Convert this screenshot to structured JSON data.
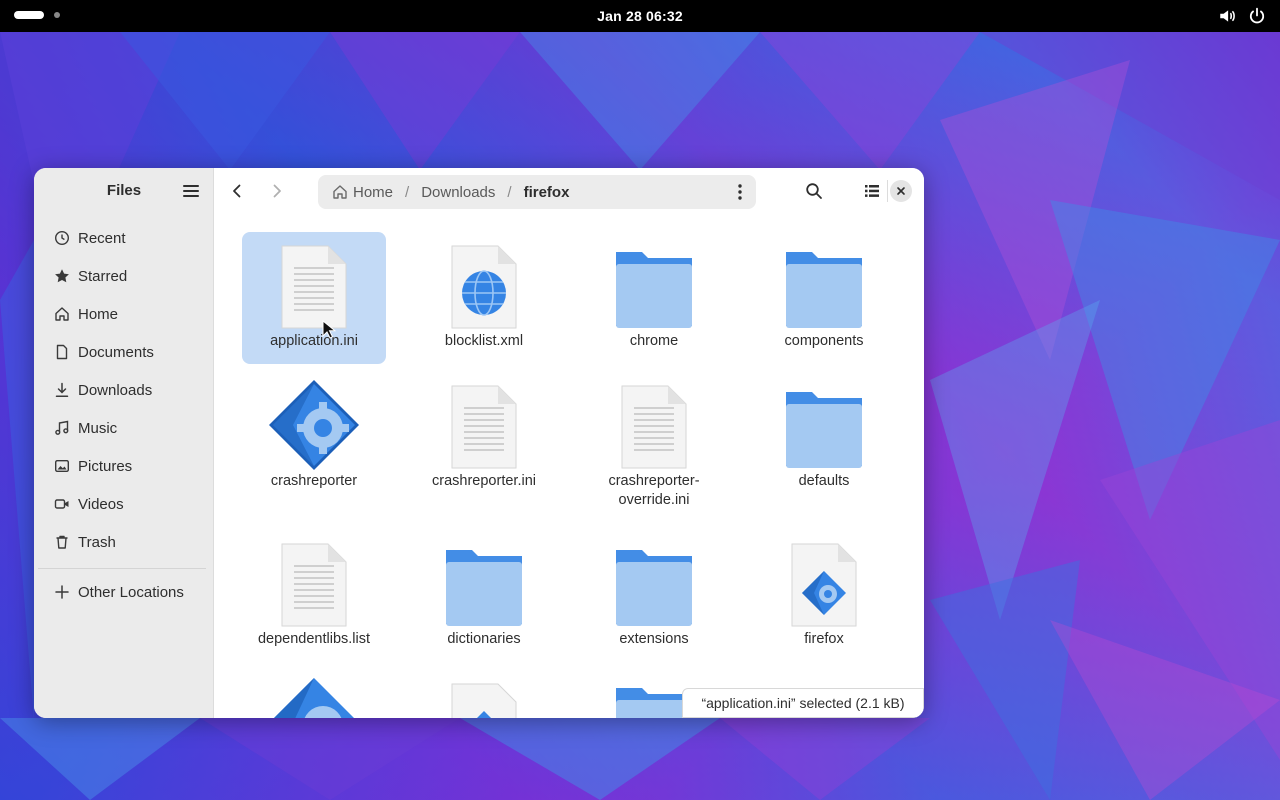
{
  "topbar": {
    "clock": "Jan 28  06:32",
    "tray_icons": [
      "volume-icon",
      "power-icon"
    ]
  },
  "window": {
    "sidebar": {
      "title": "Files",
      "items": [
        {
          "label": "Recent",
          "icon": "clock-icon"
        },
        {
          "label": "Starred",
          "icon": "star-icon"
        },
        {
          "label": "Home",
          "icon": "home-icon"
        },
        {
          "label": "Documents",
          "icon": "document-icon"
        },
        {
          "label": "Downloads",
          "icon": "download-icon"
        },
        {
          "label": "Music",
          "icon": "music-icon"
        },
        {
          "label": "Pictures",
          "icon": "picture-icon"
        },
        {
          "label": "Videos",
          "icon": "video-icon"
        },
        {
          "label": "Trash",
          "icon": "trash-icon"
        }
      ],
      "other_locations": "Other Locations"
    },
    "pathbar": {
      "crumbs": [
        "Home",
        "Downloads",
        "firefox"
      ],
      "separator": "/"
    },
    "files": [
      {
        "name": "application.ini",
        "type": "text",
        "selected": true
      },
      {
        "name": "blocklist.xml",
        "type": "web"
      },
      {
        "name": "chrome",
        "type": "folder"
      },
      {
        "name": "components",
        "type": "folder"
      },
      {
        "name": "crashreporter",
        "type": "executable"
      },
      {
        "name": "crashreporter.ini",
        "type": "text"
      },
      {
        "name": "crashreporter-override.ini",
        "type": "text"
      },
      {
        "name": "defaults",
        "type": "folder"
      },
      {
        "name": "dependentlibs.list",
        "type": "text"
      },
      {
        "name": "dictionaries",
        "type": "folder"
      },
      {
        "name": "extensions",
        "type": "folder"
      },
      {
        "name": "firefox",
        "type": "executable-doc"
      }
    ],
    "status": "“application.ini” selected  (2.1 kB)"
  },
  "colors": {
    "accent": "#3584e4",
    "folder_back": "#438de6",
    "folder_front": "#a4c9f2",
    "selection": "#c3daf6"
  }
}
